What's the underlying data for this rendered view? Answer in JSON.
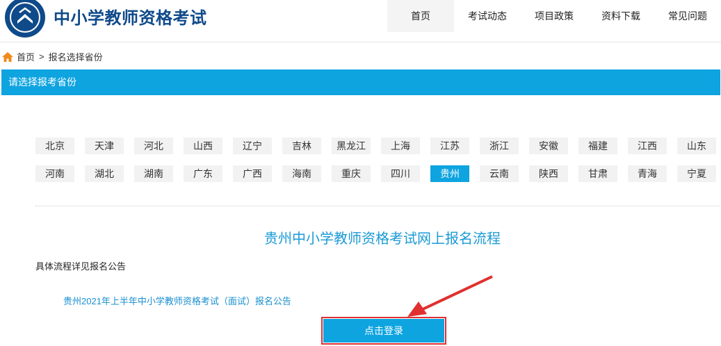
{
  "header": {
    "site_title": "中小学教师资格考试",
    "nav": [
      "首页",
      "考试动态",
      "项目政策",
      "资料下载",
      "常见问题"
    ],
    "active_nav": "首页"
  },
  "breadcrumb": {
    "home": "首页",
    "separator": ">",
    "current": "报名选择省份"
  },
  "section_title": "请选择报考省份",
  "provinces": [
    [
      "北京",
      "天津",
      "河北",
      "山西",
      "辽宁",
      "吉林",
      "黑龙江",
      "上海",
      "江苏",
      "浙江",
      "安徽",
      "福建",
      "江西",
      "山东"
    ],
    [
      "河南",
      "湖北",
      "湖南",
      "广东",
      "广西",
      "海南",
      "重庆",
      "四川",
      "贵州",
      "云南",
      "陕西",
      "甘肃",
      "青海",
      "宁夏"
    ]
  ],
  "selected_province": "贵州",
  "flow_title": "贵州中小学教师资格考试网上报名流程",
  "detail_text": "具体流程详见报名公告",
  "notice_link": "贵州2021年上半年中小学教师资格考试（面试）报名公告",
  "login_button": "点击登录",
  "colors": {
    "accent": "#0ea4e0",
    "title_blue": "#0f4a8a",
    "highlight_red": "#e03030"
  }
}
